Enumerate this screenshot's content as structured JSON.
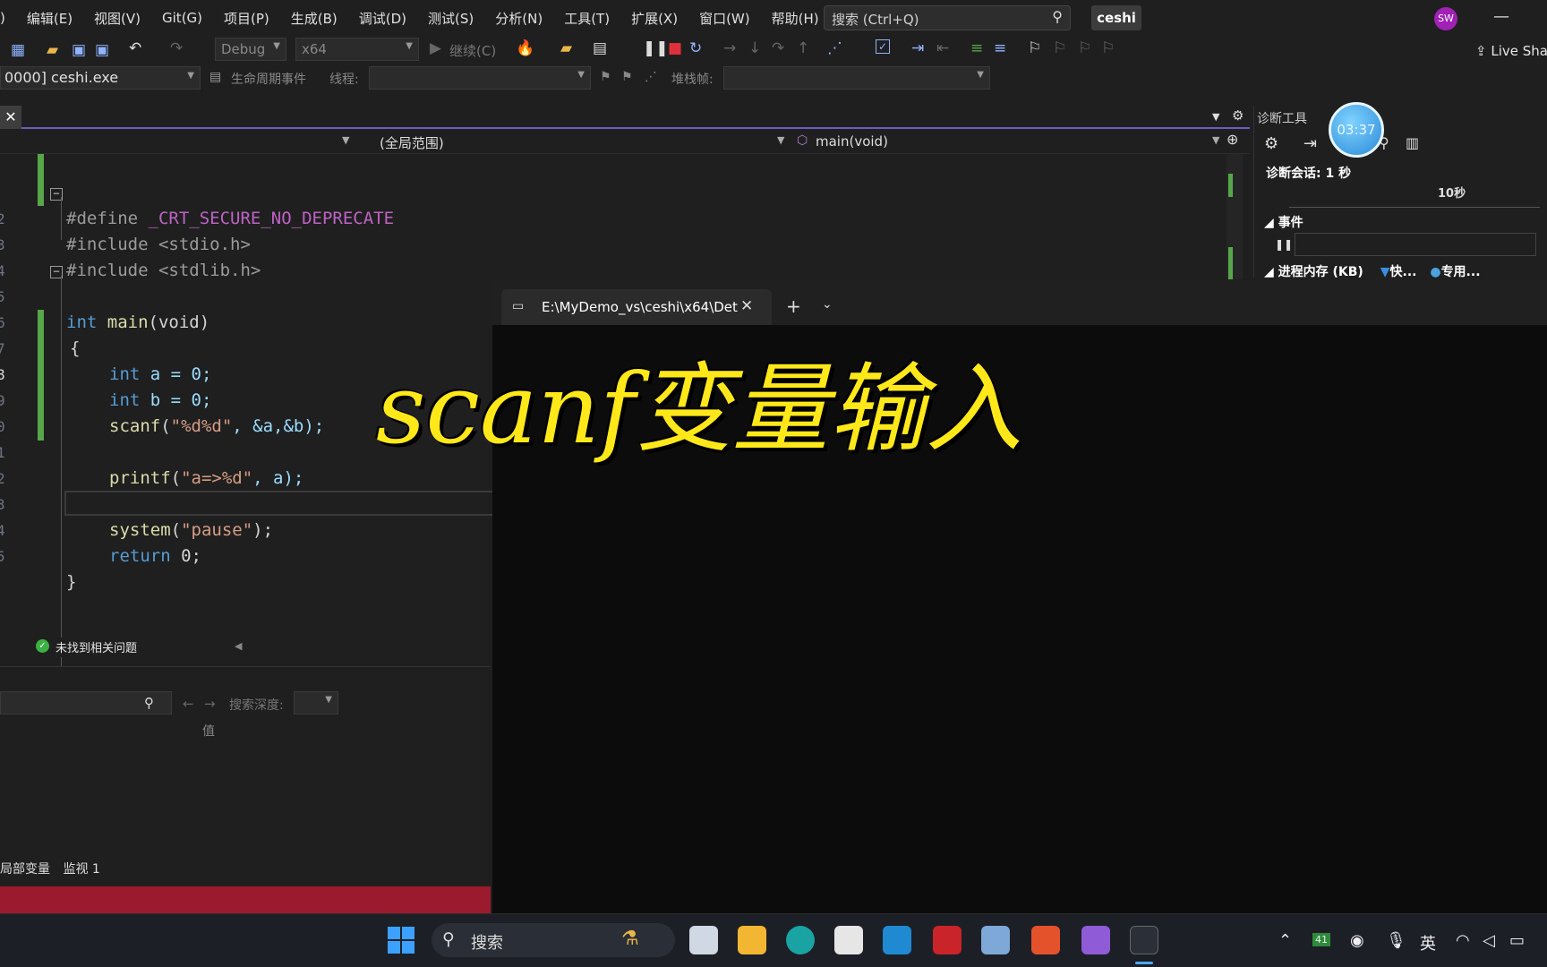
{
  "menu": {
    "items": [
      ")",
      "编辑(E)",
      "视图(V)",
      "Git(G)",
      "项目(P)",
      "生成(B)",
      "调试(D)",
      "测试(S)",
      "分析(N)",
      "工具(T)",
      "扩展(X)",
      "窗口(W)",
      "帮助(H)"
    ],
    "search_placeholder": "搜索 (Ctrl+Q)",
    "project_name": "ceshi",
    "avatar_initials": "SW"
  },
  "toolbar": {
    "config": "Debug",
    "platform": "x64",
    "continue_label": "继续(C)",
    "live_share": "Live Sha"
  },
  "debugbar": {
    "process": "0000] ceshi.exe",
    "lifecycle_label": "生命周期事件",
    "thread_label": "线程:",
    "stackframe_label": "堆栈帧:"
  },
  "navbar": {
    "scope": "(全局范围)",
    "function": "main(void)"
  },
  "code": {
    "line_numbers": [
      "",
      "2",
      "3",
      "4",
      "5",
      "6",
      "7",
      "8",
      "9",
      "0",
      "1",
      "2",
      "3",
      "4",
      "5"
    ],
    "l1_directive": "#define",
    "l1_macro": "_CRT_SECURE_NO_DEPRECATE",
    "l2": "#include <stdio.h>",
    "l3": "#include <stdlib.h>",
    "l5_kw": "int",
    "l5_func": "main",
    "l5_args": "(void)",
    "l6": "{",
    "l7_kw": "int",
    "l7_rest": "a = 0;",
    "l8_kw": "int",
    "l8_rest": "b = 0;",
    "l9_func": "scanf",
    "l9_str": "\"%d%d\"",
    "l9_rest": ", &a,&b);",
    "l11_func": "printf",
    "l11_str": "\"a=>%d\"",
    "l11_rest": ", a);",
    "l13_func": "system",
    "l13_str": "\"pause\"",
    "l13_rest": ");",
    "l14_kw": "return",
    "l14_rest": "0;",
    "l15": "}"
  },
  "status": {
    "issues": "未找到相关问题"
  },
  "locals": {
    "search_depth_label": "搜索深度:",
    "value_column": "值",
    "tabs": [
      "局部变量",
      "监视 1"
    ]
  },
  "diagnostics": {
    "title": "诊断工具",
    "timer": "03:37",
    "session": "诊断会话: 1 秒",
    "tick_10s": "10秒",
    "events": "事件",
    "memory": "进程内存 (KB)",
    "snapshot": "快...",
    "private": "专用..."
  },
  "terminal": {
    "tab_title": "E:\\MyDemo_vs\\ceshi\\x64\\Det"
  },
  "overlay_title": "scanf变量输入",
  "taskbar": {
    "search_label": "搜索",
    "tray_badge": "41",
    "ime": "英"
  }
}
